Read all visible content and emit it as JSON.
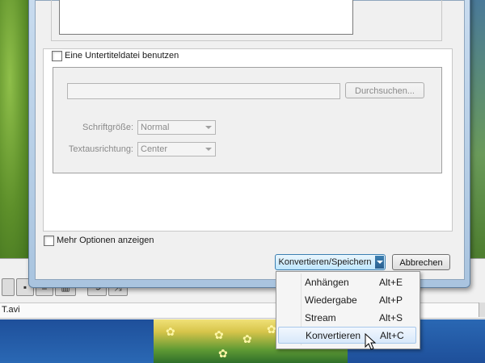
{
  "dialog": {
    "subtitle_checkbox_label": "Eine Untertiteldatei benutzen",
    "subtitle_file_value": "",
    "browse_label": "Durchsuchen...",
    "font_size_label": "Schriftgröße:",
    "font_size_value": "Normal",
    "alignment_label": "Textausrichtung:",
    "alignment_value": "Center",
    "more_options_label": "Mehr Optionen anzeigen",
    "convert_save_label": "Konvertieren/Speichern",
    "cancel_label": "Abbrechen"
  },
  "menu": {
    "items": [
      {
        "label": "Anhängen",
        "shortcut": "Alt+E"
      },
      {
        "label": "Wiedergabe",
        "shortcut": "Alt+P"
      },
      {
        "label": "Stream",
        "shortcut": "Alt+S"
      },
      {
        "label": "Konvertieren",
        "shortcut": "Alt+C"
      }
    ],
    "highlighted_index": 3
  },
  "player": {
    "status_filename": "T.avi"
  },
  "colors": {
    "accent": "#3c7fb1",
    "menu_highlight": "#d8e8fa"
  }
}
